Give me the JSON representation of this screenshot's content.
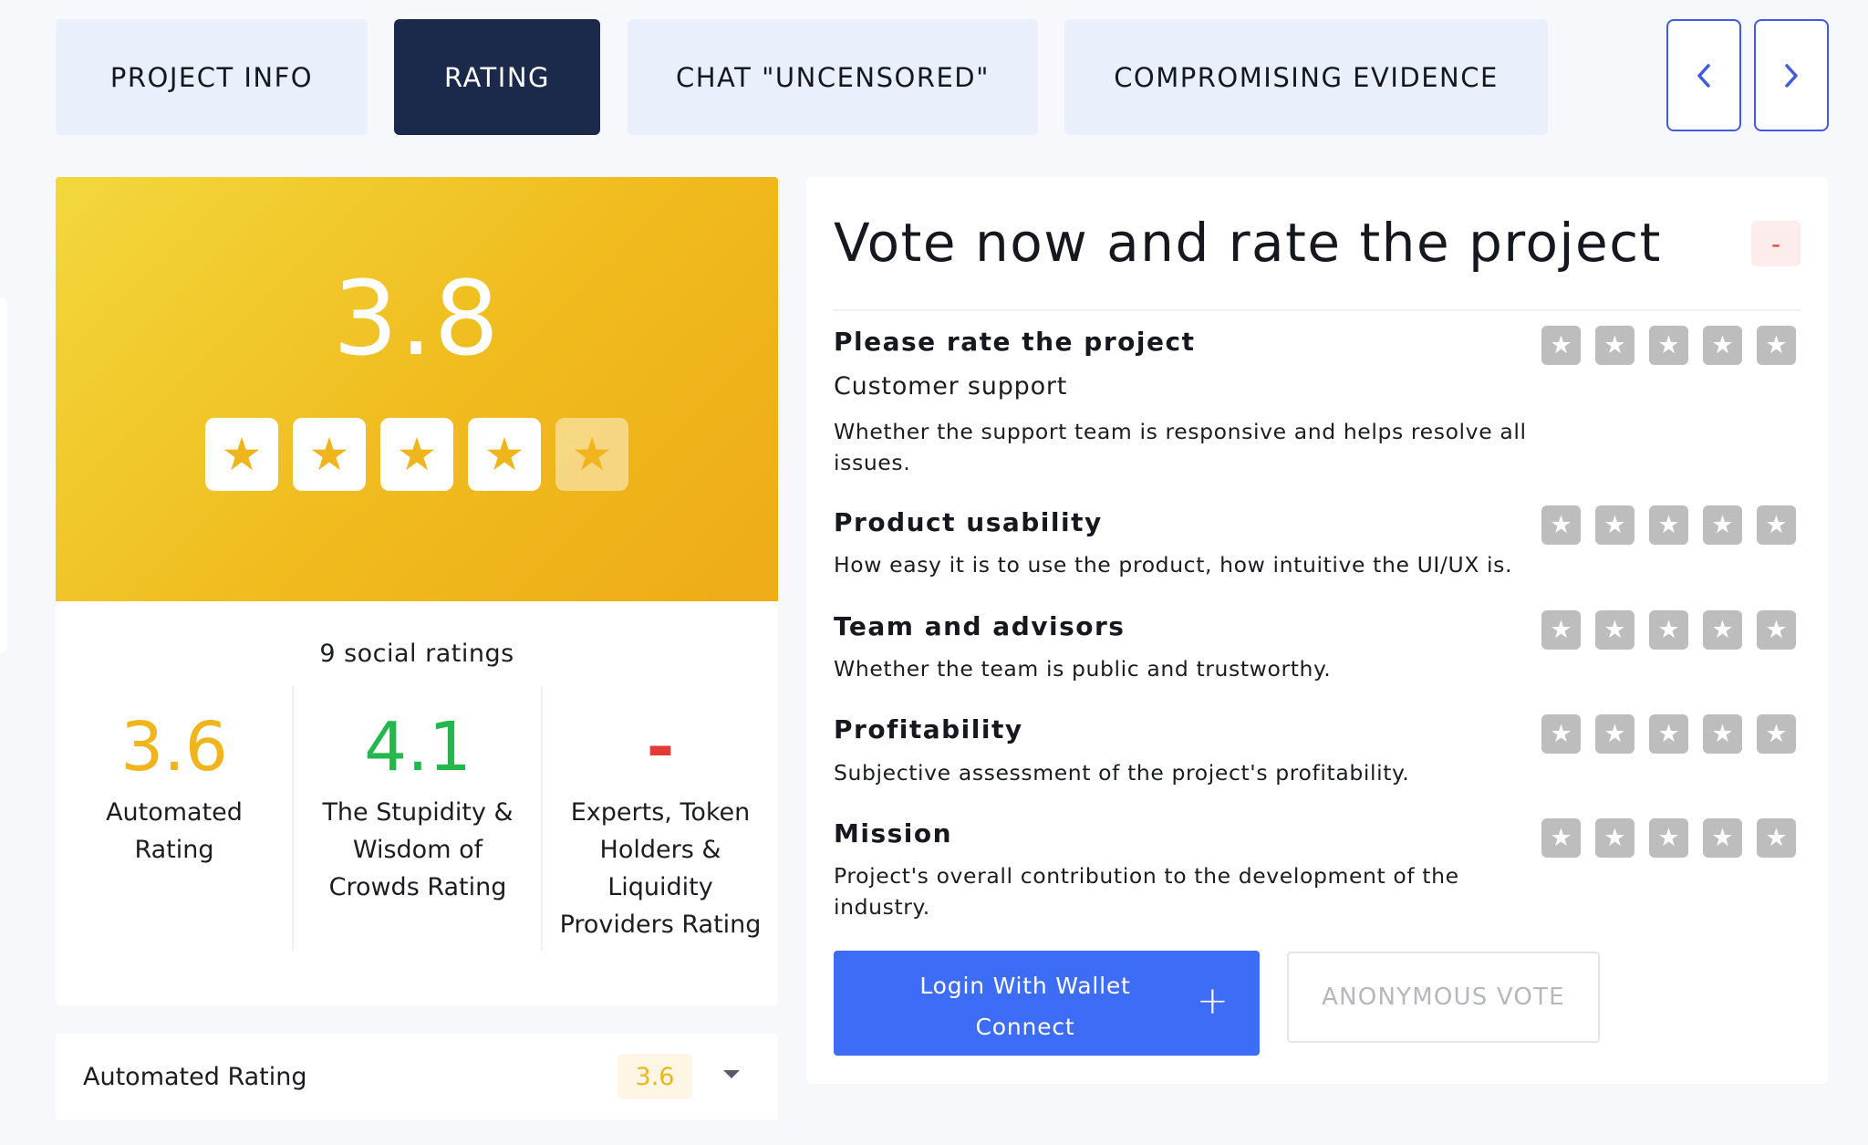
{
  "tabs": [
    {
      "label": "PROJECT INFO",
      "active": false
    },
    {
      "label": "RATING",
      "active": true
    },
    {
      "label": "CHAT \"UNCENSORED\"",
      "active": false
    },
    {
      "label": "COMPROMISING EVIDENCE",
      "active": false
    }
  ],
  "nav": {
    "prev_icon": "chevron-left-icon",
    "next_icon": "chevron-right-icon"
  },
  "colors": {
    "accent_blue": "#3d6df6",
    "dark_navy": "#1b2a4a",
    "rating_yellow": "#f0b51c",
    "rating_green": "#22b84c",
    "rating_red": "#e53935",
    "star_gray": "#bdbdbd"
  },
  "overall": {
    "score": "3.8",
    "stars_filled": 4,
    "stars_total": 5,
    "social_ratings": "9 social ratings"
  },
  "sub_ratings": [
    {
      "value": "3.6",
      "label_lines": [
        "Automated",
        "Rating"
      ],
      "color": "#f0b51c"
    },
    {
      "value": "4.1",
      "label_lines": [
        "The Stupidity &",
        "Wisdom of",
        "Crowds Rating"
      ],
      "color": "#22b84c"
    },
    {
      "value": "-",
      "label_lines": [
        "Experts, Token",
        "Holders &",
        "Liquidity",
        "Providers Rating"
      ],
      "color": "#e53935"
    }
  ],
  "automated_rating": {
    "label": "Automated Rating",
    "value": "3.6"
  },
  "vote": {
    "title": "Vote now and rate the project",
    "collapse_label": "-",
    "intro": "Please rate the project",
    "criteria": [
      {
        "title": "Customer support",
        "description": "Whether the support team is responsive and helps resolve all issues.",
        "rating": 0
      },
      {
        "title": "Product usability",
        "description": "How easy it is to use the product, how intuitive the UI/UX is.",
        "rating": 0
      },
      {
        "title": "Team and advisors",
        "description": "Whether the team is public and trustworthy.",
        "rating": 0
      },
      {
        "title": "Profitability",
        "description": "Subjective assessment of the project's profitability.",
        "rating": 0
      },
      {
        "title": "Mission",
        "description": "Project's overall contribution to the development of the industry.",
        "rating": 0
      }
    ],
    "login_button": "Login With Wallet Connect",
    "login_icon": "plus-icon",
    "anonymous_button": "ANONYMOUS VOTE"
  },
  "star_glyph": "★"
}
